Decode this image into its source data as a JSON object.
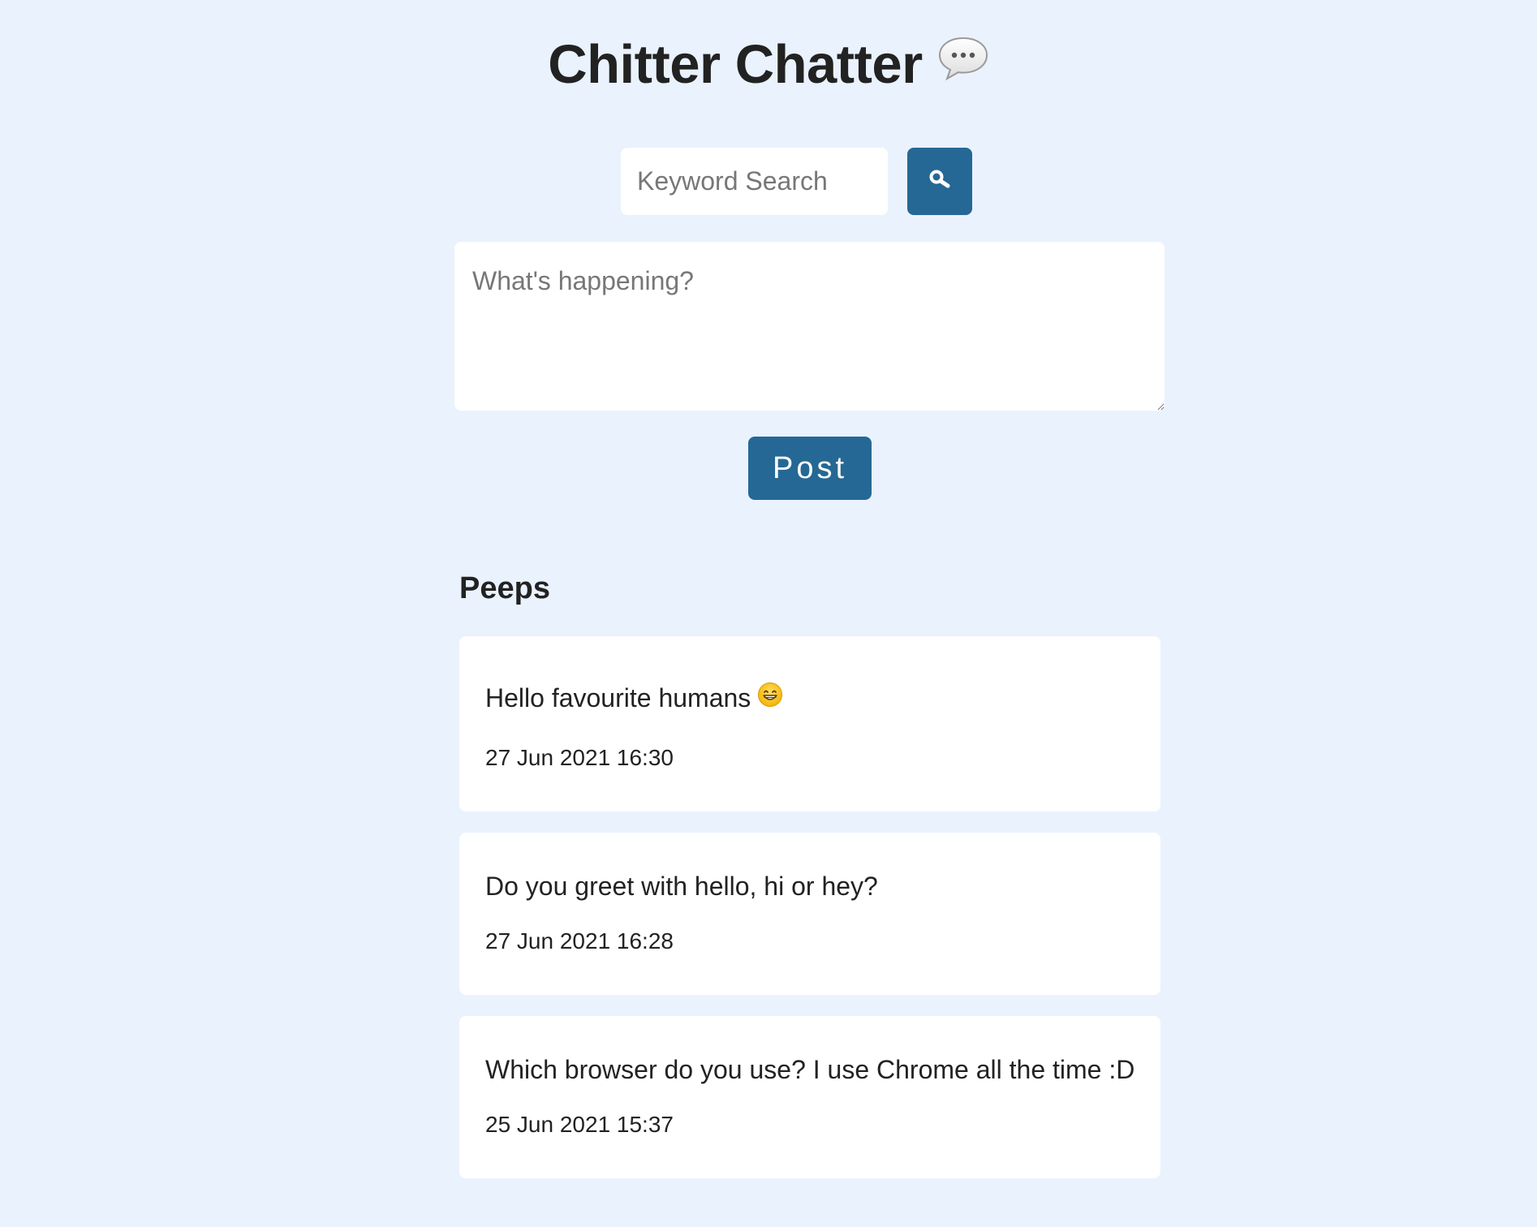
{
  "header": {
    "title": "Chitter Chatter",
    "title_icon": "speech-bubble-icon"
  },
  "search": {
    "placeholder": "Keyword Search",
    "value": "",
    "button_icon": "search-icon"
  },
  "compose": {
    "placeholder": "What's happening?",
    "value": ""
  },
  "post_button": {
    "label": "Post"
  },
  "peeps": {
    "heading": "Peeps",
    "items": [
      {
        "text": "Hello favourite humans",
        "emoji_icon": "grinning-face-icon",
        "time": "27 Jun 2021 16:30"
      },
      {
        "text": "Do you greet with hello, hi or hey?",
        "time": "27 Jun 2021 16:28"
      },
      {
        "text": "Which browser do you use? I use Chrome all the time :D",
        "time": "25 Jun 2021 15:37"
      }
    ]
  },
  "colors": {
    "background": "#eaf2fd",
    "accent": "#256895",
    "card": "#ffffff",
    "text": "#222222"
  }
}
